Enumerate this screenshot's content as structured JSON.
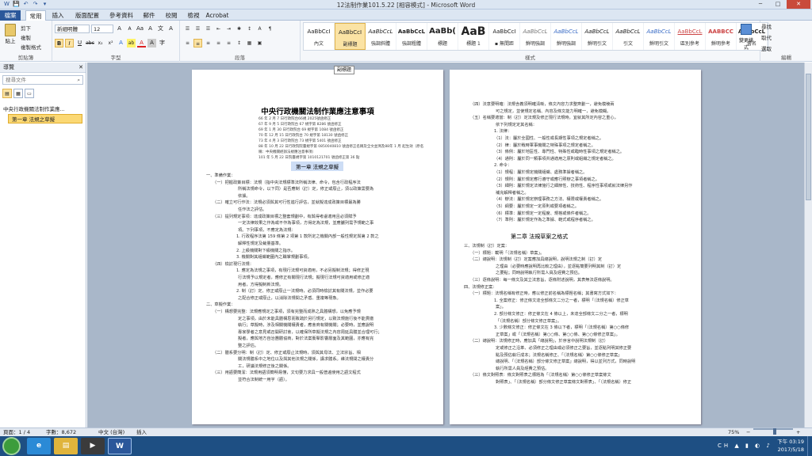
{
  "window": {
    "title": "12法制作業101.5.22 [相容模式] - Microsoft Word",
    "min": "─",
    "max": "□",
    "close": "✕",
    "qat": [
      "W",
      "💾",
      "↶",
      "↷",
      "▾"
    ]
  },
  "tabs": [
    "檔案",
    "常用",
    "插入",
    "版面配置",
    "參考資料",
    "郵件",
    "校閱",
    "檢視",
    "Acrobat"
  ],
  "ribbon": {
    "clipboard": {
      "label": "剪貼簿",
      "paste": "貼上",
      "cut": "剪下",
      "copy": "複製",
      "format_painter": "複製格式"
    },
    "font": {
      "label": "字型",
      "name": "新細明體",
      "size": "12",
      "grow": "A",
      "shrink": "A",
      "aa": "Aa",
      "clear": "A",
      "phon": "文",
      "border": "A",
      "bold": "B",
      "italic": "I",
      "underline": "U",
      "strike": "abc",
      "sub": "x₂",
      "sup": "x²",
      "effects": "A",
      "highlight": "ab",
      "color": "A",
      "shade": "A",
      "circle": "字"
    },
    "paragraph": {
      "label": "段落",
      "buttons": [
        "☰",
        "☰",
        "☰",
        "⇤",
        "⇥",
        "✱",
        "↕",
        "A",
        "¶",
        "≡",
        "≡",
        "≡",
        "≡",
        "≡",
        "↕",
        "▦",
        "▣"
      ]
    },
    "styles": {
      "label": "樣式",
      "items": [
        {
          "sample": "AaBbCcI",
          "name": "內文"
        },
        {
          "sample": "AaBbCcI",
          "name": "副標題"
        },
        {
          "sample": "AaBbCcL",
          "name": "強調斜體"
        },
        {
          "sample": "AaBbCcL",
          "name": "強調粗體"
        },
        {
          "sample": "AaBb(",
          "name": "標題"
        },
        {
          "sample": "AaB",
          "name": "標題 1"
        },
        {
          "sample": "AaBbCcI",
          "name": "▪ 無間距"
        },
        {
          "sample": "AaBbCcL",
          "name": "鮮明強調"
        },
        {
          "sample": "AaBbCcL",
          "name": "鮮明強調"
        },
        {
          "sample": "AaBbCcL",
          "name": "鮮明引文"
        },
        {
          "sample": "AaBbCcL",
          "name": "引文"
        },
        {
          "sample": "AaBbCcL",
          "name": "鮮明引文"
        },
        {
          "sample": "AaBbCcL",
          "name": "區別參考"
        },
        {
          "sample": "AABBCC",
          "name": "鮮明參考"
        },
        {
          "sample": "AaBbCcL",
          "name": "書名"
        }
      ],
      "change": "變更樣式"
    },
    "editing": {
      "label": "編輯",
      "find": "尋找",
      "replace": "取代",
      "select": "選取"
    }
  },
  "nav": {
    "title": "導覽",
    "close": "✕",
    "search_placeholder": "搜尋文件",
    "tabs": [
      "▤",
      "▦",
      "▭"
    ],
    "tree": [
      "中央行政機關法制作業應...",
      "第一章 法規之草擬"
    ]
  },
  "tooltip": "副標題",
  "page1": {
    "title": "中央行政機關法制作業應注意事項",
    "history": [
      "66 年 2 月 7 日行政院台66規 2025號函修正",
      "67 年 9 月 5 日行政院台 67 規字第 8286 號函修正",
      "69 年 1 月 30 日行政院台 69 規字第 1084 號函修正",
      "70 年 12 月 15 日行政院台 70 規字第 18130 號函修正",
      "73 年 4 月 3 日行政院台 73 規字第 5401 號函修正",
      "88 年 10 月 22 日行政院院臺規字第 0850040810 號函修正名稱及全文並溯及88年 1 月 起生效（原名稱：中央機關經辦法規應注意事項）",
      "101 年 5 月 22 日院臺規字第 1010121701 號函修正第 36 點"
    ],
    "chapter": "第一章  法規之草擬",
    "lines": [
      "一、準備作業：",
      "（一）把握政策目標：法規（指中央法規標準法所稱法律、命令，包含行政程序法",
      "所稱法規命令，以下同）是否應制（訂）定，修正或廢止，須以政策需要為",
      "依據。",
      "（二）確立可行作法：法規必須與其可行性進行評估，並就擬達成政策目標最為勝",
      "任作法之評估。",
      "（三）提列規定事項：達成政策目標之整套規劃中，有與得考慮適用且必須賦予",
      "一定法律效果之作為或不作為事項，方得定為法規，並應臚列需予規範之事",
      "項。下列事項，不應定為法規：",
      "1. 行政程序法第 159 條第 2 項第 1 款所定之機關內部一般性規定與第 2 款之",
      "解釋性規定及裁量基準。",
      "2. 上級機關對下級機關之指示。",
      "3. 機關對其組織範圍內之職掌規劃事項。",
      "（四）檢討現行法規：",
      "1. 應定為法規之事項，有現行法規可資適用，不必另擬制法規；得修正現",
      "行法規予以規定者，應修正有關現行法規；擬現行法規可資適用或修正適",
      "用者，方得擬制新法規。",
      "2. 制（訂）定、修正或廢止一法規時，必須同時檢討其有關法規，並作必要",
      "之配合修正或廢止，以消除法規間之矛盾、重複等現象。",
      "二、草擬作業：",
      "（一）構想要完整：法規應規定之事項，須有完整而成熟之具體構想，以免應予規",
      "定之事項，由於未能具體構思而致疏於另行規定，以致法規施行後不能貫徹",
      "執行；草擬時，涉及相關機關權責者，應會商有關機關；必要時，並應說明",
      "專家學者之意見或召開研討會，以確保所草擬法規之內容周延具體並合理可行；",
      "擬者，應與地方自治團體協商，對於法案衝擊影響層面及其範圍，亦應有完",
      "整之評估。",
      "（二）體系要分明：制（訂）定、修正或廢止法規時，須與其母法、立法宗旨、相",
      "關法規體系中之地位以及與其他法規之關係，講求體系。維法規間之權責分",
      "工，研議法規修正後之關係。",
      "（三）用語要簡潔：法規用語須簡明易懂，文句要力求具一般普遍使用之語文程式",
      "並符合法制統一用字（語）。"
    ]
  },
  "page2": {
    "lines": [
      "（四）法意要明確：法規含義須明確清晰，條文內容力求整齊劃一，避免模稜兩",
      "可之規定，並使規定名稱、內容及條文能力明確一，避免模糊。",
      "（五）名稱要適當：制（訂）定法規及修正現行法規時，宜就其所定內容之重心，",
      "依下列規定定其名稱：",
      "1. 法律：",
      "（1）法：屬於全國性、一般性或長期性事項之規定者稱之。",
      "（2）律：屬於戰時軍事機關之特殊事項之規定者稱之。",
      "（3）條例：屬於地區性、專門性、特殊性或臨時性事項之規定者稱之。",
      "（4）通則：屬於同一類事項共通適用之原則或組織之規定者稱之。",
      "2. 命令：",
      "（1）規程：屬於規定機關組織、處務準據者稱之。",
      "（2）規則：屬於規定應行遵守或應行照辦之事項者稱之。",
      "（3）細則：屬於規定法律施行之細節性、技術性、程序性事項或就法律另作",
      "補充解釋者稱之。",
      "（4）辦法：屬於規定辦理事務之方法、權限或權責者稱之。",
      "（5）綱要：屬於規定一定原則或要項者稱之。",
      "（6）標準：屬於規定一定程度、規格或條件者稱之。",
      "（7）準則：屬於規定作為之準據、範式或程序者稱之。"
    ],
    "chapter": "第二章  法規草案之格式",
    "lines2": [
      "三、法規制（訂）定案：",
      "（一）標題：載明「（法規名稱）草案」。",
      "（二）總說明：法規制（訂）定案應加具總說明，說明法規之制（訂）定",
      "之理由（必要時應說明再比較之理由），並逐點簡要列明其制（訂）定",
      "之要點；同時說明執行所需人員及經費之預估。",
      "（三）逐條說明：每一條文及其立法意旨，逐條附述說明，其表無法逐條說明。",
      "四、法規修正案：",
      "（一）標題：法規名稱有修正時，應以修正前名稱為標題名稱；其書寫方式如下：",
      "1. 全案修正：修正條文達全部條文二分之一者，標明「（法規名稱）修正草",
      "案」。",
      "2. 部分條文修正：修正條文在 4 條以上，未達全部條文二分之一者，標明",
      "「（法規名稱）部分條文修正草案」。",
      "3. 少數條文修正：修正條文在 3 條以下者，標明「（法規名稱）第○○條修",
      "正草案」或「（法規名稱）第○○條、第○○條、第○○條修正草案」。",
      "（二）總說明：法規修正時，應加具「總說明」，於序言中說明法規制（訂）",
      "定或修正之沿革、必須修正之理由或必須修正之要旨，並逐點列明其修正要",
      "點及預估執行成本；法規名稱修正、「（法規名稱）第○○條修正草案」",
      "總說明、「（法規名稱）部分條文修正草案」總說明，得以並列方式，同時說明",
      "執行所需人員及經費之預估。",
      "（三）條文對照表：條文對照表之標題為「（法規名稱）第○○條修正草案條文",
      "對照表」、「（法規名稱）部分條文修正草案條文對照表」、「（法規名稱）修正"
    ]
  },
  "status": {
    "page": "頁面：1 / 4",
    "words": "字數：8,672",
    "lang": "中文 (台灣)",
    "mode": "插入",
    "zoom": "75%",
    "minus": "−",
    "plus": "+"
  },
  "taskbar": {
    "time": "下午 03:19",
    "date": "2017/5/18",
    "tray": "CH ▲ ▮ ◐ ♪"
  },
  "colors": {
    "accent": "#2b579a",
    "highlight": "#fbd874",
    "taskbar": "#1e4f83",
    "doc_bg": "#a9b7c9"
  }
}
